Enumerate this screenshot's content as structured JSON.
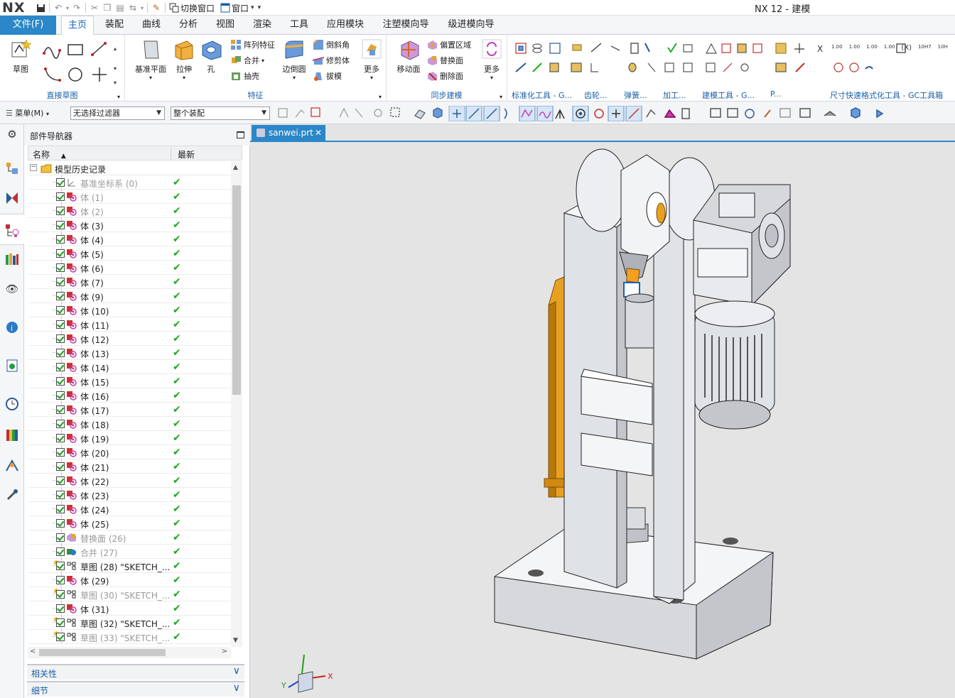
{
  "app": {
    "logo": "NX",
    "window_title": "NX 12 - 建模"
  },
  "quick_access": {
    "switch_window": "切换窗口",
    "window_menu": "窗口"
  },
  "menu_tabs": [
    {
      "label": "文件(F)"
    },
    {
      "label": "主页"
    },
    {
      "label": "装配"
    },
    {
      "label": "曲线"
    },
    {
      "label": "分析"
    },
    {
      "label": "视图"
    },
    {
      "label": "渲染"
    },
    {
      "label": "工具"
    },
    {
      "label": "应用模块"
    },
    {
      "label": "注塑模向导"
    },
    {
      "label": "级进模向导"
    }
  ],
  "active_tab": "主页",
  "ribbon": {
    "sketch_group": {
      "label": "直接草图",
      "sketch": "草图"
    },
    "feature_group": {
      "label": "特征",
      "datum_plane": "基准平面",
      "extrude": "拉伸",
      "hole": "孔",
      "pattern_feature": "阵列特征",
      "unite": "合并",
      "shell": "抽壳",
      "edge_blend": "边倒圆",
      "chamfer": "倒斜角",
      "trim_body": "修剪体",
      "draft": "拔模",
      "more": "更多"
    },
    "sync_group": {
      "label": "同步建模",
      "move_face": "移动面",
      "offset_region": "偏置区域",
      "replace_face": "替换面",
      "delete_face": "删除面",
      "more": "更多"
    },
    "std_tools": "标准化工具 - G...",
    "gear": "齿轮...",
    "spring": "弹簧...",
    "machining": "加工...",
    "modeling_tools": "建模工具 - G...",
    "p_label": "P...",
    "dim_tools": "尺寸快速格式化工具 - GC工具箱",
    "dim_tags": [
      "1.00",
      "1.00",
      "1.00",
      "1.00",
      "(X)",
      "10H7",
      "10H"
    ]
  },
  "toolbar": {
    "menu": "菜单(M)",
    "filter": "无选择过滤器",
    "scope": "整个装配"
  },
  "navigator": {
    "title": "部件导航器",
    "col_name": "名称",
    "col_latest": "最新",
    "root": "模型历史记录",
    "items": [
      {
        "label": "基准坐标系 (0)",
        "dim": true,
        "kind": "csys"
      },
      {
        "label": "体 (1)",
        "dim": true,
        "kind": "body"
      },
      {
        "label": "体 (2)",
        "dim": true,
        "kind": "body"
      },
      {
        "label": "体 (3)",
        "dim": false,
        "kind": "body"
      },
      {
        "label": "体 (4)",
        "dim": false,
        "kind": "body"
      },
      {
        "label": "体 (5)",
        "dim": false,
        "kind": "body"
      },
      {
        "label": "体 (6)",
        "dim": false,
        "kind": "body"
      },
      {
        "label": "体 (7)",
        "dim": false,
        "kind": "body"
      },
      {
        "label": "体 (9)",
        "dim": false,
        "kind": "body"
      },
      {
        "label": "体 (10)",
        "dim": false,
        "kind": "body"
      },
      {
        "label": "体 (11)",
        "dim": false,
        "kind": "body"
      },
      {
        "label": "体 (12)",
        "dim": false,
        "kind": "body"
      },
      {
        "label": "体 (13)",
        "dim": false,
        "kind": "body"
      },
      {
        "label": "体 (14)",
        "dim": false,
        "kind": "body"
      },
      {
        "label": "体 (15)",
        "dim": false,
        "kind": "body"
      },
      {
        "label": "体 (16)",
        "dim": false,
        "kind": "body"
      },
      {
        "label": "体 (17)",
        "dim": false,
        "kind": "body"
      },
      {
        "label": "体 (18)",
        "dim": false,
        "kind": "body"
      },
      {
        "label": "体 (19)",
        "dim": false,
        "kind": "body"
      },
      {
        "label": "体 (20)",
        "dim": false,
        "kind": "body"
      },
      {
        "label": "体 (21)",
        "dim": false,
        "kind": "body"
      },
      {
        "label": "体 (22)",
        "dim": false,
        "kind": "body"
      },
      {
        "label": "体 (23)",
        "dim": false,
        "kind": "body"
      },
      {
        "label": "体 (24)",
        "dim": false,
        "kind": "body"
      },
      {
        "label": "体 (25)",
        "dim": false,
        "kind": "body"
      },
      {
        "label": "替换面 (26)",
        "dim": true,
        "kind": "replace"
      },
      {
        "label": "合并 (27)",
        "dim": true,
        "kind": "unite"
      },
      {
        "label": "草图 (28) \"SKETCH_...",
        "dim": false,
        "kind": "sketch"
      },
      {
        "label": "体 (29)",
        "dim": false,
        "kind": "body"
      },
      {
        "label": "草图 (30) \"SKETCH_...",
        "dim": true,
        "kind": "sketch"
      },
      {
        "label": "体 (31)",
        "dim": false,
        "kind": "body"
      },
      {
        "label": "草图 (32) \"SKETCH_...",
        "dim": false,
        "kind": "sketch"
      },
      {
        "label": "草图 (33) \"SKETCH_...",
        "dim": true,
        "kind": "sketch"
      }
    ],
    "panels": {
      "dependencies": "相关性",
      "details": "细节"
    }
  },
  "document_tab": {
    "name": "sanwei.prt"
  },
  "triad": {
    "x_label": "X",
    "y_label": "Y"
  },
  "colors": {
    "accent": "#2b87c8",
    "orange": "#e8a020",
    "check": "#1faa1f"
  }
}
